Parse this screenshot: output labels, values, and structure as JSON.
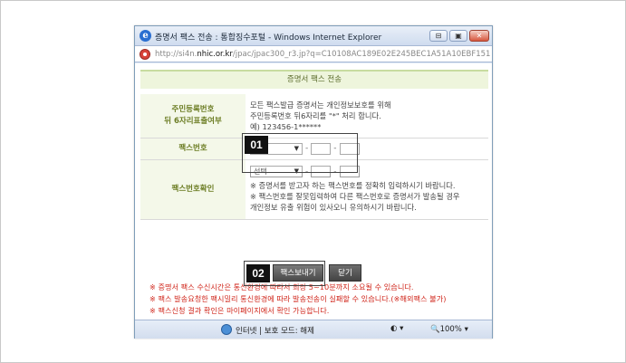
{
  "window": {
    "title": "증명서 팩스 전송 : 통합징수포털 - Windows Internet Explorer",
    "url_prefix": "http://si4n.",
    "url_domain": "nhic.or.kr",
    "url_rest": "/jpac/jpac300_r3.jp?q=C10108AC189E02E245BEC1A51A10EBF151A780C7(",
    "buttons": {
      "minimize": "⊟",
      "restore": "▣",
      "close": "✕"
    }
  },
  "page": {
    "title": "증명서 팩스 전송",
    "rows": [
      {
        "label_line1": "주민등록번호",
        "label_line2": "뒤 6자리표출여부",
        "lines": [
          "모든 팩스발급 증명서는 개인정보보호를 위해",
          "주민등록번호 뒤6자리를 \"*\" 처리 합니다.",
          "예) 123456-1******"
        ]
      },
      {
        "label": "팩스번호",
        "select_value": "선택"
      },
      {
        "label": "팩스번호확인",
        "select_value": "선택",
        "lines": [
          "※ 증명서를 받고자 하는 팩스번호를 정확히 입력하시기 바랍니다.",
          "※ 팩스번호를 잘못입력하여 다른 팩스번호로 증명서가 발송될 경우",
          "개인정보 유출 위험이 있사오니 유의하시기 바랍니다."
        ]
      }
    ],
    "dropdown_option": "선택",
    "notes": [
      "※ 증명서 팩스 수신시간은 통신환경에 따라서 최장 5~10분까지 소요될 수 있습니다.",
      "※ 팩스 발송요청한 팩시밀리 통신환경에 따라 발송전송이 실패할 수 있습니다.(※해외팩스 불가)",
      "※ 팩스신청 결과 확인은 마이페이지에서 확인 가능합니다."
    ],
    "send_button": "팩스보내기",
    "close_button": "닫기"
  },
  "callouts": {
    "first": "01",
    "second": "02"
  },
  "statusbar": {
    "text": "인터넷 | 보호 모드: 해제",
    "icons": "◐ ▾",
    "zoom": "🔍100%  ▾"
  }
}
